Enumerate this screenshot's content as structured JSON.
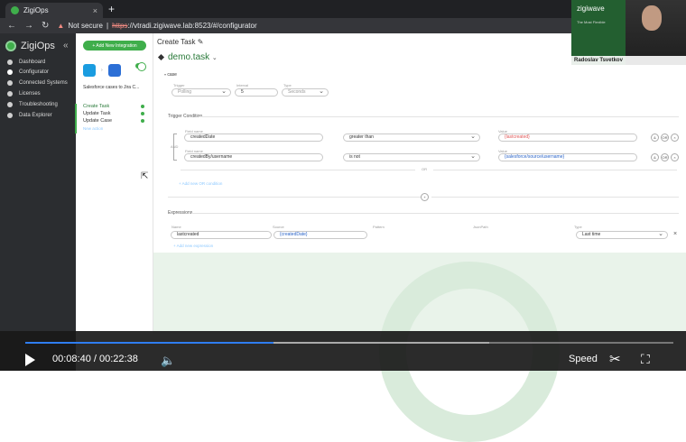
{
  "browser": {
    "tab_title": "ZigiOps",
    "tab_close": "×",
    "new_tab": "+",
    "nav_back": "←",
    "nav_forward": "→",
    "reload": "↻",
    "security_label": "Not secure",
    "url_scheme": "https",
    "url_rest": "://vtradi.zigiwave.lab:8523/#/configurator"
  },
  "sidebar": {
    "app_name": "ZigiOps",
    "collapse": "«",
    "items": [
      {
        "label": "Dashboard"
      },
      {
        "label": "Configurator"
      },
      {
        "label": "Connected Systems"
      },
      {
        "label": "Licenses"
      },
      {
        "label": "Troubleshooting"
      },
      {
        "label": "Data Explorer"
      }
    ]
  },
  "integration": {
    "add_button": "+ Add New Integration",
    "name": "Salesforce cases to Jira C...",
    "operations": [
      {
        "label": "Create Task"
      },
      {
        "label": "Update Task"
      },
      {
        "label": "Update Case"
      }
    ],
    "add_action": "New action"
  },
  "page": {
    "title": "Create Task",
    "edit_icon": "✎",
    "operation": "demo.task",
    "case_label": "case"
  },
  "trigger": {
    "trigger_label": "Trigger",
    "trigger_value": "Polling",
    "interval_label": "Interval",
    "interval_value": "5",
    "type_label": "Type",
    "type_value": "Seconds"
  },
  "conditions": {
    "section": "Trigger Condition",
    "and_label": "AND",
    "or_label": "OR",
    "rows": [
      {
        "field_label": "Field name",
        "field": "createdDate",
        "op": "greater than",
        "value_label": "Value",
        "value": "{lastcreated}"
      },
      {
        "field_label": "Field name",
        "field": "createdBy/username",
        "op": "is not",
        "value_label": "Value",
        "value": "{salesforce/source/username}"
      }
    ],
    "btn_and": "&",
    "btn_or": "OR",
    "btn_remove": "×",
    "add_label": "+ Add new OR condition",
    "add_group": "+"
  },
  "expressions": {
    "section": "Expressions",
    "name_label": "Name",
    "source_label": "Source",
    "pattern_label": "Pattern",
    "jsonpath_label": "JsonPath",
    "type_label": "Type",
    "name": "lastcreated",
    "source": "{createdDate}",
    "type": "Last time",
    "remove": "×",
    "add_label": "+ Add new expression"
  },
  "webcam": {
    "brand": "zigiwave",
    "tagline": "The Most Flexible",
    "presenter": "Radoslav Tsvetkov"
  },
  "video": {
    "current": "00:08:40",
    "separator": "/",
    "duration": "00:22:38",
    "progress": 0.383,
    "buffered": 0.716,
    "speed_label": "Speed"
  },
  "colors": {
    "accent": "#3fae4b",
    "sidebar_bg": "#2b2d30",
    "value_red": "#e05656",
    "value_blue": "#2a64c8",
    "progress_blue": "#2f7df0"
  }
}
